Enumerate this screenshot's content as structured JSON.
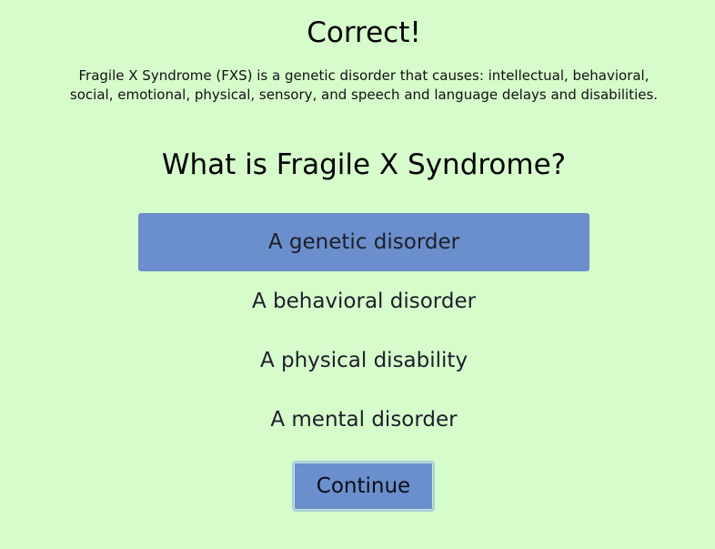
{
  "feedback": {
    "title": "Correct!",
    "explanation_line1": "Fragile X Syndrome (FXS) is a genetic disorder that causes: intellectual, behavioral,",
    "explanation_line2": "social, emotional, physical, sensory, and speech and language delays and disabilities."
  },
  "quiz": {
    "question": "What is Fragile X Syndrome?",
    "options": [
      {
        "label": "A genetic disorder",
        "selected": true
      },
      {
        "label": "A behavioral disorder",
        "selected": false
      },
      {
        "label": "A physical disability",
        "selected": false
      },
      {
        "label": "A mental disorder",
        "selected": false
      }
    ],
    "continue_label": "Continue"
  },
  "colors": {
    "background": "#d6fccc",
    "selected_option": "#6a8fcc",
    "button": "#6a8fcc"
  }
}
